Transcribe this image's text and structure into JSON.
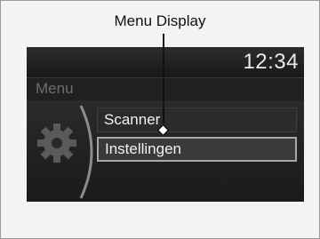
{
  "callout": {
    "label": "Menu Display"
  },
  "screen": {
    "clock": "12:34",
    "menu_title": "Menu",
    "items": [
      {
        "label": "Scanner",
        "selected": false
      },
      {
        "label": "Instellingen",
        "selected": true
      }
    ],
    "icon": "gear-icon"
  }
}
